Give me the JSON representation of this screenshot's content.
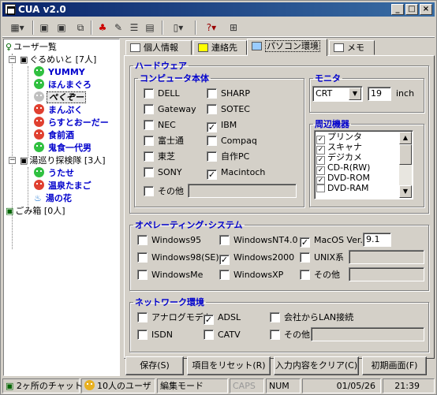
{
  "window": {
    "title": "CUA v2.0",
    "minimize": "_",
    "maximize": "□",
    "close": "×"
  },
  "tree": {
    "root": "ユーザ一覧",
    "groups": [
      {
        "label": "ぐるめいと [7人]",
        "members": [
          {
            "name": "YUMMY",
            "color": "g"
          },
          {
            "name": "ほんまぐろ",
            "color": "g"
          },
          {
            "name": "ぺくぞー",
            "color": "w"
          },
          {
            "name": "まんぷく",
            "color": "r"
          },
          {
            "name": "らすとおーだー",
            "color": "r"
          },
          {
            "name": "食前酒",
            "color": "r"
          },
          {
            "name": "鬼食一代男",
            "color": "g"
          }
        ]
      },
      {
        "label": "湯巡り探検隊 [3人]",
        "members": [
          {
            "name": "うたせ",
            "color": "g"
          },
          {
            "name": "温泉たまご",
            "color": "r"
          },
          {
            "name": "湯の花",
            "color": "blue"
          }
        ]
      }
    ],
    "trash": "ごみ箱 [0人]"
  },
  "tabs": [
    {
      "label": "個人情報",
      "active": false
    },
    {
      "label": "連絡先",
      "active": false
    },
    {
      "label": "パソコン環境",
      "active": true
    },
    {
      "label": "メモ",
      "active": false
    }
  ],
  "hardware": {
    "legend": "ハードウェア",
    "computer_legend": "コンピュータ本体",
    "makers": [
      {
        "label": "DELL",
        "checked": false
      },
      {
        "label": "SHARP",
        "checked": false
      },
      {
        "label": "Gateway",
        "checked": false
      },
      {
        "label": "SOTEC",
        "checked": false
      },
      {
        "label": "NEC",
        "checked": false
      },
      {
        "label": "IBM",
        "checked": true
      },
      {
        "label": "富士通",
        "checked": false
      },
      {
        "label": "Compaq",
        "checked": false
      },
      {
        "label": "東芝",
        "checked": false
      },
      {
        "label": "自作PC",
        "checked": false
      },
      {
        "label": "SONY",
        "checked": false
      },
      {
        "label": "Macintoch",
        "checked": true
      }
    ],
    "other_label": "その他",
    "monitor_legend": "モニタ",
    "monitor_type": "CRT",
    "monitor_size": "19",
    "monitor_unit": "inch",
    "peripherals_legend": "周辺機器",
    "peripherals": [
      {
        "label": "プリンタ",
        "checked": true
      },
      {
        "label": "スキャナ",
        "checked": true
      },
      {
        "label": "デジカメ",
        "checked": true
      },
      {
        "label": "CD-R(RW)",
        "checked": true
      },
      {
        "label": "DVD-ROM",
        "checked": true
      },
      {
        "label": "DVD-RAM",
        "checked": false
      }
    ]
  },
  "os": {
    "legend": "オペレーティング･システム",
    "items": [
      {
        "label": "Windows95",
        "checked": false
      },
      {
        "label": "WindowsNT4.0",
        "checked": false
      },
      {
        "label": "MacOS Ver.",
        "checked": true
      },
      {
        "label": "Windows98(SE)",
        "checked": false
      },
      {
        "label": "Windows2000",
        "checked": true
      },
      {
        "label": "UNIX系",
        "checked": false
      },
      {
        "label": "WindowsMe",
        "checked": false
      },
      {
        "label": "WindowsXP",
        "checked": false
      },
      {
        "label": "その他",
        "checked": false
      }
    ],
    "mac_version": "9.1"
  },
  "network": {
    "legend": "ネットワーク環境",
    "items": [
      {
        "label": "アナログモデム",
        "checked": false
      },
      {
        "label": "ADSL",
        "checked": true
      },
      {
        "label": "会社からLAN接続",
        "checked": false
      },
      {
        "label": "ISDN",
        "checked": false
      },
      {
        "label": "CATV",
        "checked": false
      },
      {
        "label": "その他",
        "checked": false
      }
    ]
  },
  "buttons": {
    "save": "保存(S)",
    "reset": "項目をリセット(R)",
    "clear": "入力内容をクリア(C)",
    "home": "初期画面(F)"
  },
  "status": {
    "chat": "2ヶ所のチャット",
    "users": "10人のユーザ",
    "mode": "編集モード",
    "caps": "CAPS",
    "num": "NUM",
    "date": "01/05/26",
    "time": "21:39"
  }
}
